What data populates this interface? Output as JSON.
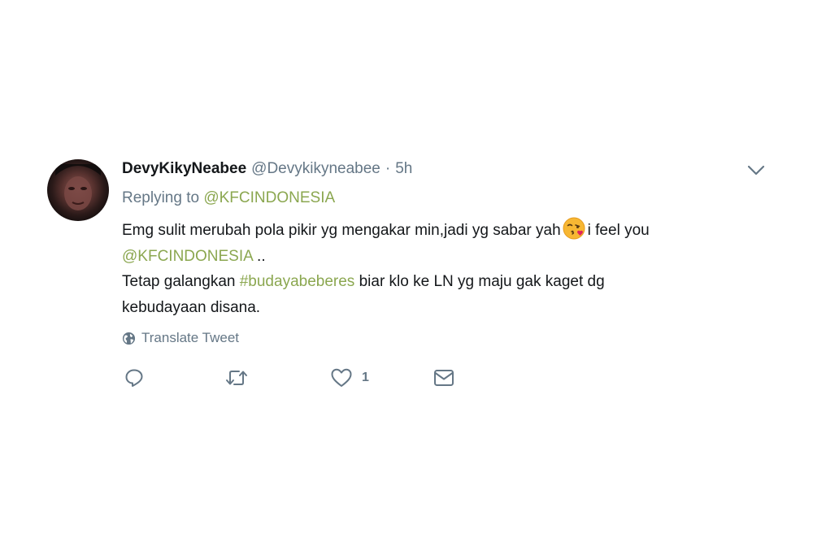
{
  "tweet": {
    "display_name": "DevyKikyNeabee",
    "handle": "@Devykikyneabee",
    "separator": "·",
    "time": "5h",
    "replying_prefix": "Replying to",
    "replying_to": "@KFCINDONESIA",
    "text": {
      "line1_pre": "Emg sulit merubah pola pikir yg mengakar min,jadi yg sabar yah",
      "line1_post": "i feel you",
      "line2_mention": "@KFCINDONESIA",
      "line2_post": " ..",
      "line3_pre": "Tetap galangkan ",
      "line3_hashtag": "#budayabeberes",
      "line3_post": " biar klo ke LN yg maju gak kaget dg",
      "line4": "kebudayaan disana."
    },
    "emoji": "face-blowing-kiss",
    "translate_label": "Translate Tweet",
    "actions": {
      "reply_icon": "reply-icon",
      "retweet_icon": "retweet-icon",
      "like_icon": "heart-icon",
      "like_count": "1",
      "dm_icon": "envelope-icon"
    },
    "menu_icon": "chevron-down-icon"
  },
  "colors": {
    "link": "#8ba750",
    "secondary_text": "#657786",
    "primary_text": "#14171a",
    "background": "#ffffff"
  }
}
